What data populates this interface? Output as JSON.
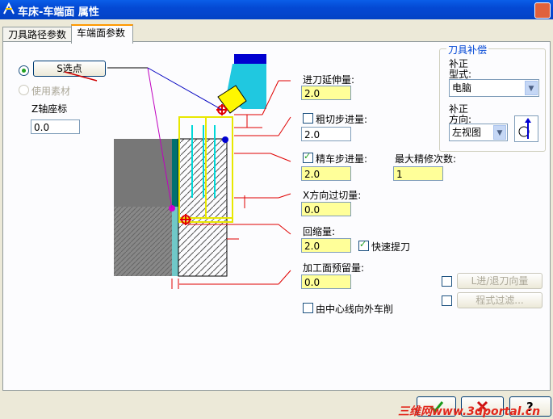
{
  "window": {
    "title": "车床-车端面 属性"
  },
  "tabs": [
    {
      "label": "刀具路径参数"
    },
    {
      "label": "车端面参数"
    }
  ],
  "left": {
    "s_point_button": "S选点",
    "use_stock_label": "使用素材",
    "z_coord_label": "Z轴座标",
    "z_coord_value": "0.0"
  },
  "params": {
    "entry_extension_label": "进刀延伸量:",
    "entry_extension_value": "2.0",
    "rough_step_label": "粗切步进量:",
    "rough_step_value": "2.0",
    "rough_step_checked": false,
    "finish_step_label": "精车步进量:",
    "finish_step_value": "2.0",
    "finish_step_checked": true,
    "max_finish_passes_label": "最大精修次数:",
    "max_finish_passes_value": "1",
    "x_overcut_label": "X方向过切量:",
    "x_overcut_value": "0.0",
    "retract_label": "回缩量:",
    "retract_value": "2.0",
    "rapid_retract_label": "快速提刀",
    "rapid_retract_checked": true,
    "finish_stock_label": "加工面预留量:",
    "finish_stock_value": "0.0",
    "from_center_label": "由中心线向外车削",
    "from_center_checked": false
  },
  "tool_comp": {
    "legend": "刀具补偿",
    "type_label_line1": "补正",
    "type_label_line2": "型式:",
    "type_value": "电脑",
    "direction_label_line1": "补正",
    "direction_label_line2": "方向:",
    "direction_value": "左视图"
  },
  "right_buttons": {
    "lead_in_out": "L进/退刀向量",
    "filter": "程式过滤..."
  },
  "footer": {
    "watermark": "三维网www.3dportal.cn"
  },
  "colors": {
    "title_bar": "#0449d4",
    "input_highlight": "#ffff99",
    "accent_orange": "#ff9900",
    "legend_blue": "#0046d5"
  }
}
